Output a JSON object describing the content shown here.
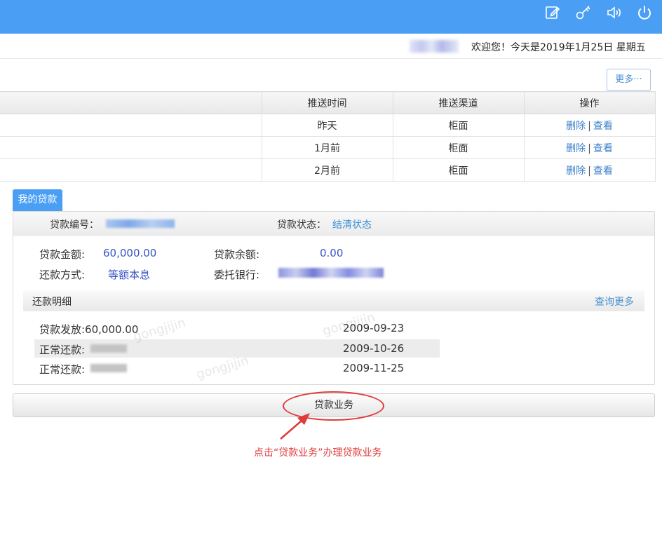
{
  "topbar": {
    "color": "#4a9ff5",
    "icons": [
      "edit-icon",
      "key-icon",
      "volume-icon",
      "power-icon"
    ]
  },
  "welcome": {
    "text": "欢迎您！今天是2019年1月25日 星期五"
  },
  "more_button": "更多···",
  "message_table": {
    "headers": [
      "推送时间",
      "推送渠道",
      "操作"
    ],
    "rows": [
      {
        "time": "昨天",
        "channel": "柜面",
        "delete": "删除",
        "sep": "|",
        "view": "查看"
      },
      {
        "time": "1月前",
        "channel": "柜面",
        "delete": "删除",
        "sep": "|",
        "view": "查看"
      },
      {
        "time": "2月前",
        "channel": "柜面",
        "delete": "删除",
        "sep": "|",
        "view": "查看"
      }
    ]
  },
  "my_loan": {
    "tab_label": "我的贷款",
    "loan_no_label": "贷款编号：",
    "status_label": "贷款状态：",
    "status_value": "结清状态",
    "amount_label": "贷款金额:",
    "amount_value": "60,000.00",
    "balance_label": "贷款余额:",
    "balance_value": "0.00",
    "method_label": "还款方式:",
    "method_value": "等额本息",
    "bank_label": "委托银行:",
    "repay_detail_label": "还款明细",
    "query_more": "查询更多",
    "repay_rows": [
      {
        "desc": "贷款发放:60,000.00",
        "date": "2009-09-23"
      },
      {
        "desc": "正常还款:",
        "date": "2009-10-26"
      },
      {
        "desc": "正常还款:",
        "date": "2009-11-25"
      }
    ]
  },
  "loan_business_button": "贷款业务",
  "annotation": {
    "text": "点击“贷款业务”办理贷款业务",
    "color": "#e03a3a"
  }
}
